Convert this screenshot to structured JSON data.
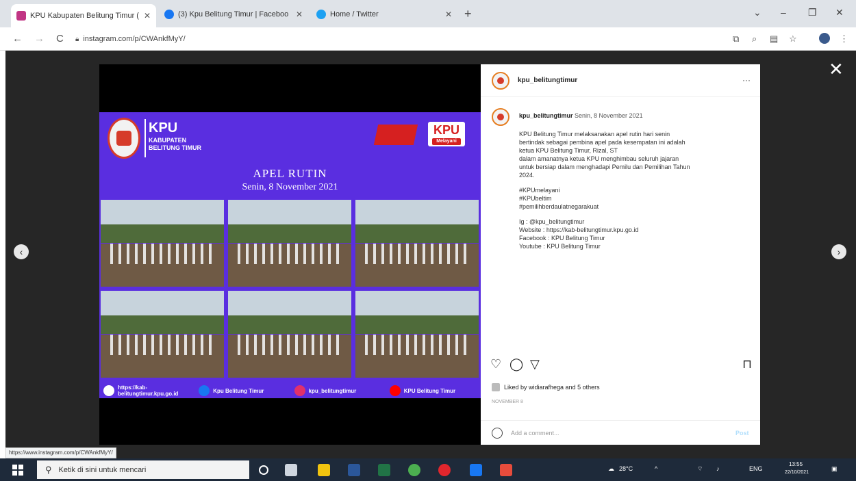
{
  "browser": {
    "tabs": [
      {
        "title": "KPU Kabupaten Belitung Timur (",
        "favicon_color": "#c13584",
        "active": true
      },
      {
        "title": "(3) Kpu Belitung Timur | Faceboo",
        "favicon_color": "#1877f2",
        "active": false
      },
      {
        "title": "Home / Twitter",
        "favicon_color": "#1da1f2",
        "active": false
      }
    ],
    "tab_close": "✕",
    "new_tab": "+",
    "window_controls": [
      "⌄",
      "–",
      "❐",
      "✕"
    ],
    "nav": {
      "back": "←",
      "forward": "→",
      "reload": "C"
    },
    "url": "instagram.com/p/CWAnkfMyY/",
    "status_url": "https://www.instagram.com/p/CWAnkfMyY/"
  },
  "post": {
    "username": "kpu_belitungtimur",
    "more": "···",
    "close": "✕",
    "prev": "‹",
    "next": "›",
    "image": {
      "kpu": "KPU",
      "kabupaten": "KABUPATEN",
      "belitung": "BELITUNG TIMUR",
      "badge_kpu": "KPU",
      "badge_sub": "Melayani",
      "apel_title": "APEL RUTIN",
      "apel_date": "Senin, 8 November 2021",
      "footer": [
        {
          "text": "https://kab-belitungtimur.kpu.go.id",
          "color": "#ffffff"
        },
        {
          "text": "Kpu Belitung Timur",
          "color": "#1877f2"
        },
        {
          "text": "kpu_belitungtimur",
          "color": "#e1306c"
        },
        {
          "text": "KPU Belitung Timur",
          "color": "#ff0000"
        }
      ]
    },
    "caption_user": "kpu_belitungtimur",
    "caption_date": "Senin, 8 November 2021",
    "caption_lines": [
      "KPU Belitung Timur melaksanakan apel rutin hari senin",
      "bertindak sebagai pembina apel pada kesempatan ini adalah",
      "ketua KPU Belitung Timur, Rizal, ST",
      "dalam amanatnya ketua KPU menghimbau seluruh jajaran",
      "untuk bersiap dalam menghadapi Pemilu dan Pemilihan Tahun",
      "2024.",
      "",
      "#KPUmelayani",
      "#KPUbeltim",
      "#pemilihberdaulatnegarakuat",
      "",
      "Ig : @kpu_belitungtimur",
      "Website : https://kab-belitungtimur.kpu.go.id",
      "Facebook : KPU Belitung Timur",
      "Youtube : KPU Belitung Timur"
    ],
    "actions": {
      "like": "♡",
      "comment": "◯",
      "share": "▽",
      "save": "⊓"
    },
    "liked_by": "Liked by widiarafhega and 5 others",
    "time_ago": "NOVEMBER 8",
    "comment_placeholder": "Add a comment...",
    "post_button": "Post"
  },
  "taskbar": {
    "search_placeholder": "Ketik di sini untuk mencari",
    "weather": "28°C",
    "lang": "ENG",
    "time": "13:55",
    "date": "22/10/2021"
  }
}
